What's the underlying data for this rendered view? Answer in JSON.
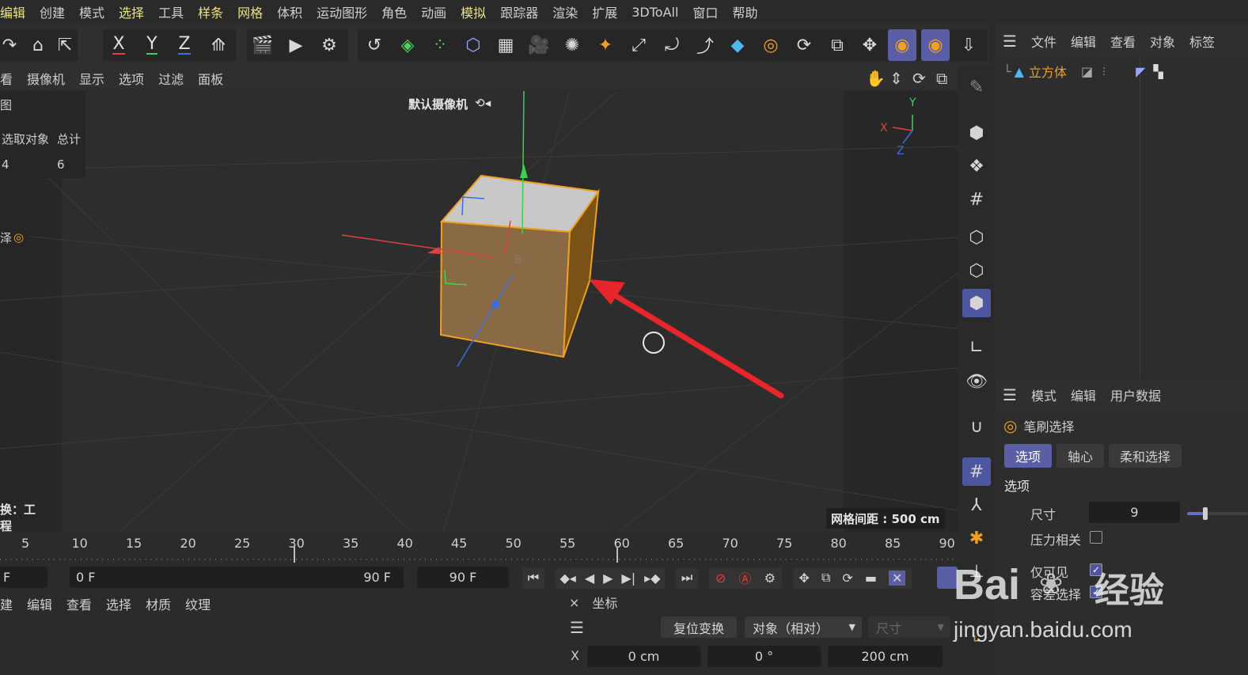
{
  "menu": [
    "编辑",
    "创建",
    "模式",
    "选择",
    "工具",
    "样条",
    "网格",
    "体积",
    "运动图形",
    "角色",
    "动画",
    "模拟",
    "跟踪器",
    "渲染",
    "扩展",
    "3DToAll",
    "窗口",
    "帮助"
  ],
  "toolbar": {
    "axis_x": "X",
    "axis_y": "Y",
    "axis_z": "Z"
  },
  "viewport_menu": [
    "看",
    "摄像机",
    "显示",
    "选项",
    "过滤",
    "面板"
  ],
  "viewport": {
    "camera_label": "默认摄像机",
    "camera_glyph": "⟲◂",
    "panel_title": "图",
    "stats_header_selected": "选取对象",
    "stats_header_total": "总计",
    "stats_selected": "4",
    "stats_total": "6",
    "mode_label": "泽",
    "project_label": "换：工程",
    "grid_spacing": "网格间距 : 500 cm",
    "point_label": "B",
    "axis_labels": {
      "x": "X",
      "y": "Y",
      "z": "Z"
    }
  },
  "timeline": {
    "ticks": [
      "5",
      "10",
      "15",
      "20",
      "25",
      "30",
      "35",
      "40",
      "45",
      "50",
      "55",
      "60",
      "65",
      "70",
      "75",
      "80",
      "85",
      "90"
    ],
    "start_field": "F",
    "current_field": "0 F",
    "end_inline": "90 F",
    "end_field": "90 F"
  },
  "object_manager": {
    "menu": [
      "文件",
      "编辑",
      "查看",
      "对象",
      "标签"
    ],
    "objects": [
      {
        "name": "立方体"
      }
    ]
  },
  "attribute_manager": {
    "menu": [
      "模式",
      "编辑",
      "用户数据"
    ],
    "tool_name": "笔刷选择",
    "tabs": [
      "选项",
      "轴心",
      "柔和选择"
    ],
    "section": "选项",
    "size_label": "尺寸",
    "size_value": "9",
    "size_fraction": 0.08,
    "pressure_label": "压力相关",
    "pressure_checked": false,
    "visible_only_label": "仅可见",
    "visible_only_checked": true,
    "tolerant_label": "容差选择",
    "tolerant_checked": true
  },
  "material_manager": {
    "menu": [
      "建",
      "编辑",
      "查看",
      "选择",
      "材质",
      "纹理"
    ]
  },
  "coord_manager": {
    "title": "坐标",
    "close": "×",
    "reset_button": "复位变换",
    "mode_select": "对象（相对）",
    "size_select": "尺寸",
    "row_label": "X",
    "position": "0 cm",
    "rotation": "0 °",
    "size": "200 cm"
  },
  "watermark": {
    "brand": "Bai",
    "product": "经验",
    "url": "jingyan.baidu.com"
  },
  "colors": {
    "menu_highlight": "#e9e384",
    "active_blue": "#5a5fa5",
    "cube_orange": "#f0a020",
    "arrow_red": "#e8252a",
    "axis_x": "#e04040",
    "axis_y": "#40d060",
    "axis_z": "#3a6ee0"
  }
}
